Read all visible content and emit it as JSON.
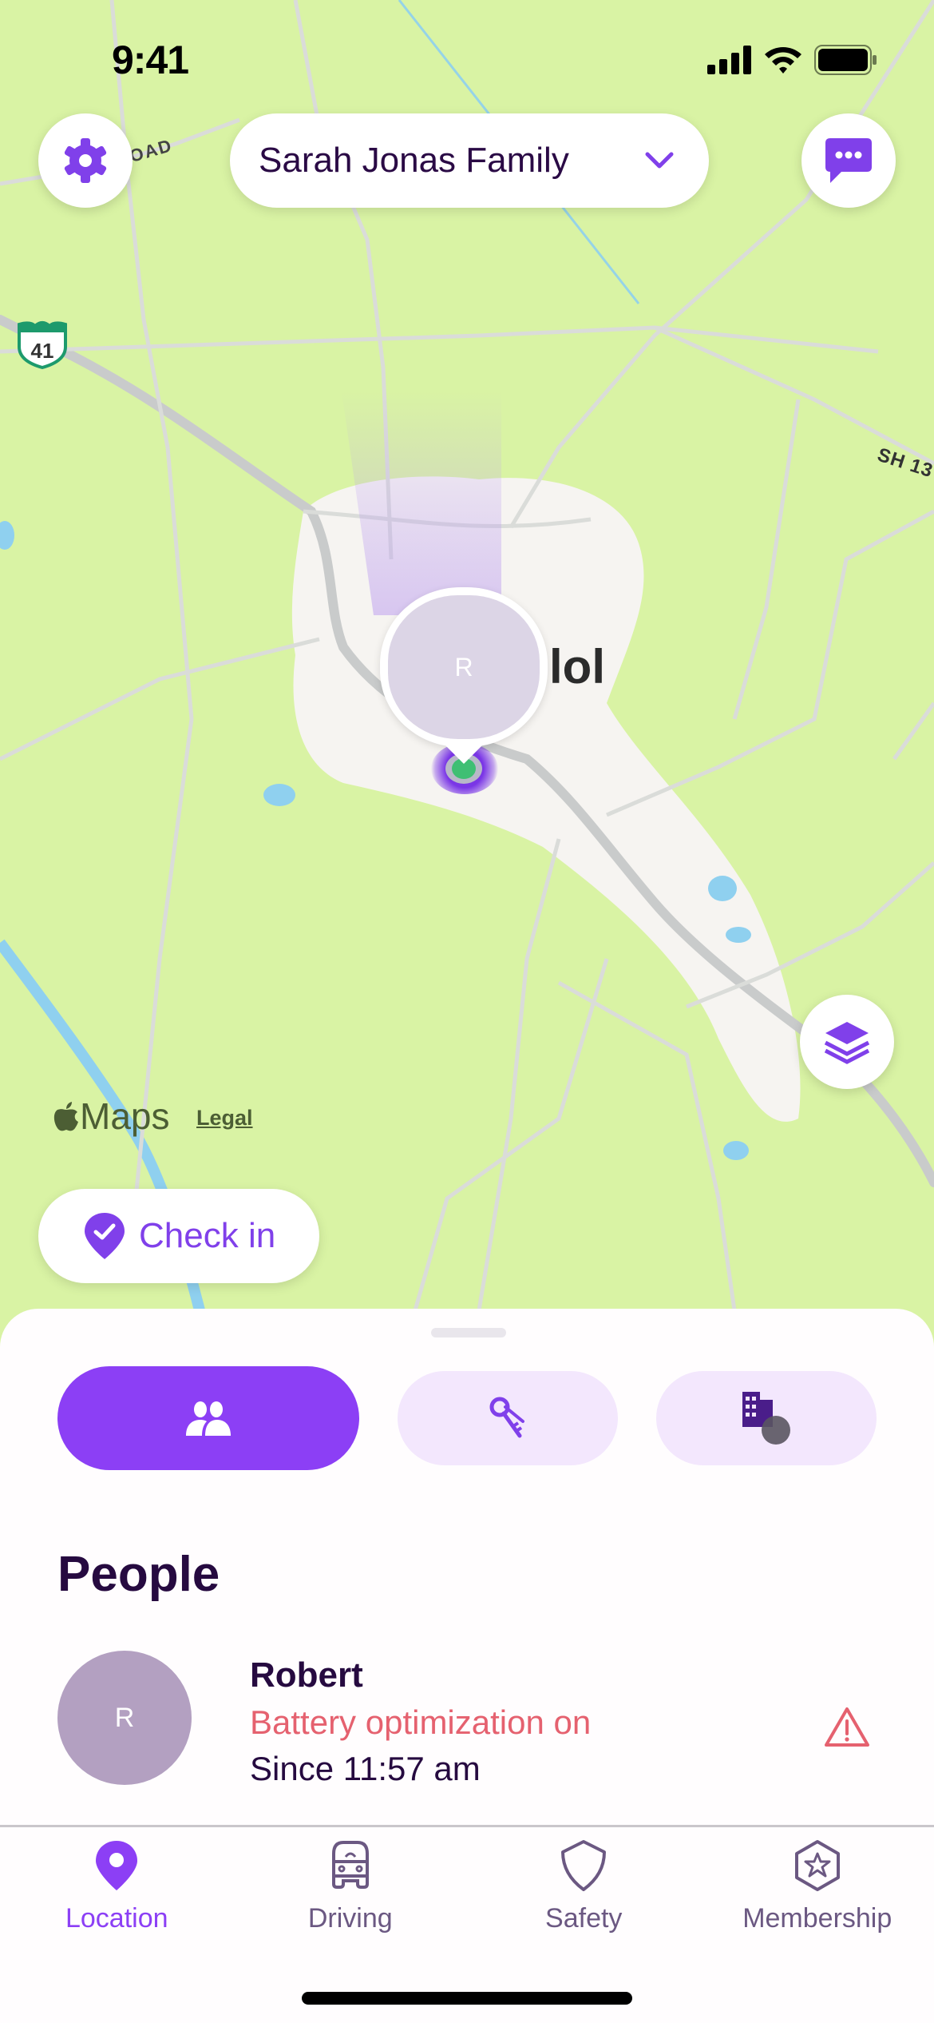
{
  "status_bar": {
    "time": "9:41"
  },
  "header": {
    "family_selector": "Sarah Jonas Family",
    "settings_icon": "gear-icon",
    "messages_icon": "chat-bubble-icon"
  },
  "map": {
    "city_label": "lol",
    "highway_shield": "41",
    "road_label_sh": "SH 13",
    "road_label_road": "OAD",
    "member_initial": "R",
    "maps_brand": "Maps",
    "legal_link": "Legal",
    "layers_icon": "layers-icon"
  },
  "check_in": {
    "label": "Check in"
  },
  "segments": [
    {
      "name": "people",
      "icon": "people-icon",
      "active": true
    },
    {
      "name": "items",
      "icon": "keys-icon",
      "active": false
    },
    {
      "name": "places",
      "icon": "buildings-icon",
      "active": false
    }
  ],
  "people": {
    "title": "People",
    "members": [
      {
        "initial": "R",
        "name": "Robert",
        "status": "Battery optimization on",
        "since": "Since 11:57 am"
      }
    ]
  },
  "tabbar": {
    "tabs": [
      {
        "label": "Location",
        "active": true
      },
      {
        "label": "Driving",
        "active": false
      },
      {
        "label": "Safety",
        "active": false
      },
      {
        "label": "Membership",
        "active": false
      }
    ]
  },
  "colors": {
    "brand_purple": "#8c3ff5",
    "dark_text": "#260a40",
    "warning_red": "#e5616f",
    "map_green": "#d9f3a4"
  }
}
